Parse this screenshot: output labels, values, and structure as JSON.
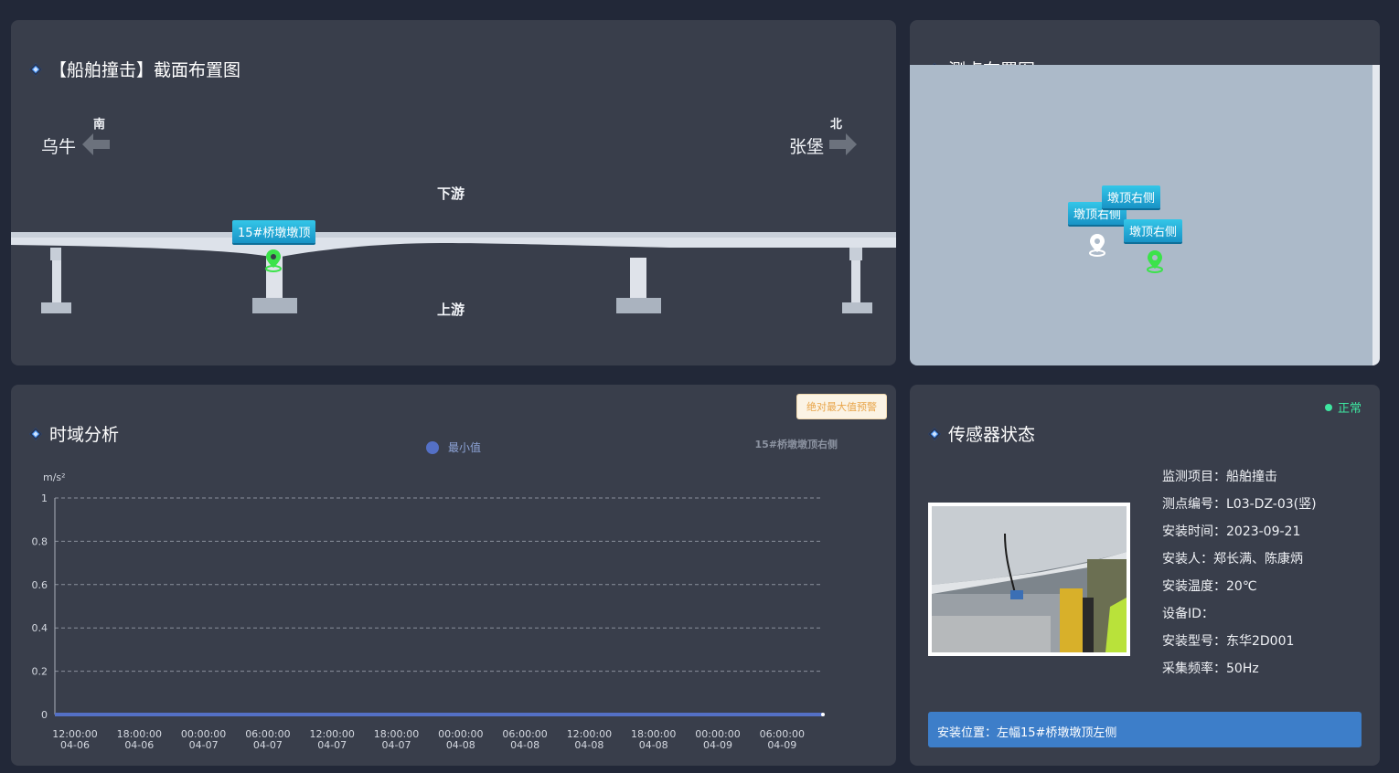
{
  "section_panel": {
    "title": "【船舶撞击】截面布置图",
    "west_place": "乌牛",
    "west_dir": "南",
    "east_place": "张堡",
    "east_dir": "北",
    "downstream": "下游",
    "upstream": "上游",
    "pier_tag": "15#桥墩墩顶"
  },
  "points_panel": {
    "title": "测点布置图",
    "markers": [
      {
        "label": "墩顶右侧",
        "state": "grey"
      },
      {
        "label": "墩顶右侧",
        "state": "none"
      },
      {
        "label": "墩顶右侧",
        "state": "green"
      }
    ]
  },
  "time_panel": {
    "title": "时域分析",
    "alarm_button": "绝对最大值预警",
    "legend": "最小值",
    "series_note": "15#桥墩墩顶右侧",
    "unit": "m/s²"
  },
  "chart_data": {
    "type": "line",
    "ylim": [
      0,
      1
    ],
    "y_ticks": [
      "0",
      "0.2",
      "0.4",
      "0.6",
      "0.8",
      "1"
    ],
    "x_ticks": [
      [
        "12:00:00",
        "04-06"
      ],
      [
        "18:00:00",
        "04-06"
      ],
      [
        "00:00:00",
        "04-07"
      ],
      [
        "06:00:00",
        "04-07"
      ],
      [
        "12:00:00",
        "04-07"
      ],
      [
        "18:00:00",
        "04-07"
      ],
      [
        "00:00:00",
        "04-08"
      ],
      [
        "06:00:00",
        "04-08"
      ],
      [
        "12:00:00",
        "04-08"
      ],
      [
        "18:00:00",
        "04-08"
      ],
      [
        "00:00:00",
        "04-09"
      ],
      [
        "06:00:00",
        "04-09"
      ]
    ],
    "series": [
      {
        "name": "最小值",
        "color": "#5470c6",
        "values": [
          0,
          0,
          0,
          0,
          0,
          0,
          0,
          0,
          0,
          0,
          0,
          0,
          0
        ]
      }
    ],
    "grid": true
  },
  "sensor_panel": {
    "title": "传感器状态",
    "status": "正常",
    "status_color": "#3ee6a0",
    "fields": [
      "监测项目：船舶撞击",
      "测点编号：L03-DZ-03(竖)",
      "安装时间：2023-09-21",
      "安装人：郑长满、陈康炳",
      "安装温度：20℃",
      "设备ID：",
      "安装型号：东华2D001",
      "采集频率：50Hz"
    ],
    "location": "安装位置：左幅15#桥墩墩顶左侧"
  },
  "colors": {
    "background": "#222838",
    "panel": "#393e4b",
    "accent": "#3f8ff5",
    "tag": "#1ea8d8",
    "location_bar": "#3d7ec9"
  }
}
